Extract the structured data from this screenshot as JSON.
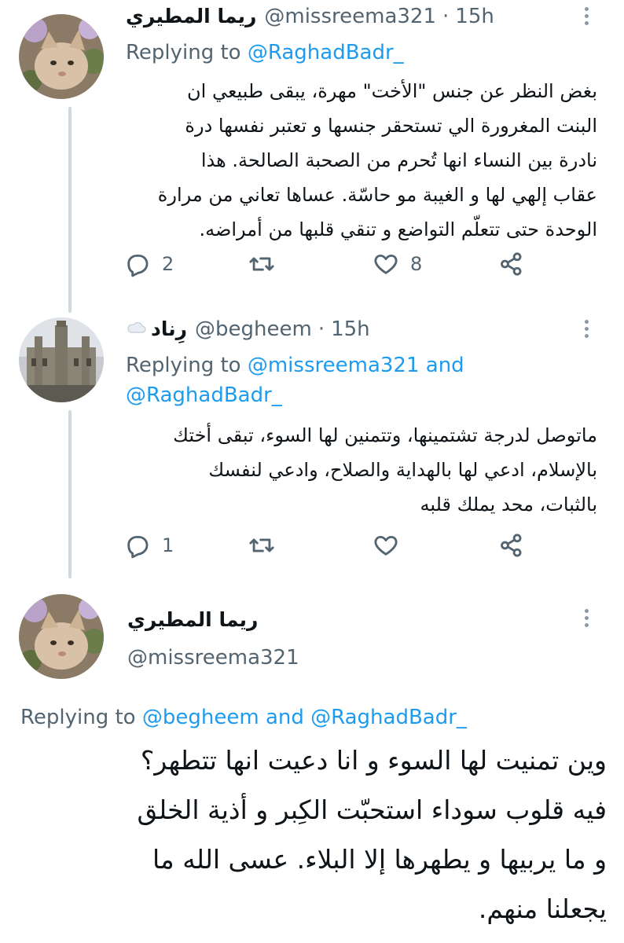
{
  "tweet1": {
    "name": "ريما المطيري",
    "handle": "@missreema321",
    "time": "15h",
    "reply_prefix": "Replying to",
    "reply_to": "@RaghadBadr_",
    "text_lines": [
      "بغض النظر عن جنس \"الأخت\" مهرة، يبقى طبيعي ان",
      "البنت المغرورة الي تستحقر جنسها و تعتبر نفسها درة",
      "نادرة بين النساء انها تُحرم من الصحبة الصالحة. هذا",
      "عقاب إلهي لها و الغيبة مو حاسّة. عساها تعاني من مرارة",
      "الوحدة حتى تتعلّم التواضع و تنقي قلبها من أمراضه."
    ],
    "replies": "2",
    "likes": "8"
  },
  "tweet2": {
    "name": "رِناد",
    "handle": "@begheem",
    "time": "15h",
    "reply_prefix": "Replying to",
    "reply_to_1": "@missreema321",
    "reply_and": "and",
    "reply_to_2": "@RaghadBadr_",
    "text_lines": [
      "ماتوصل لدرجة تشتمينها، وتتمنين لها السوء، تبقى أختك",
      "بالإسلام، ادعي لها بالهداية والصلاح، وادعي لنفسك",
      "بالثبات، محد يملك قلبه"
    ],
    "replies": "1"
  },
  "tweet3": {
    "name": "ريما المطيري",
    "handle": "@missreema321",
    "reply_prefix": "Replying to",
    "reply_to_1": "@begheem",
    "reply_and": "and",
    "reply_to_2": "@RaghadBadr_",
    "text_lines": [
      "وين تمنيت لها السوء و انا دعيت انها تتطهر؟",
      "فيه قلوب سوداء استحبّت الكِبر و أذية الخلق",
      "و ما يربيها و يطهرها إلا البلاء. عسى الله ما",
      "يجعلنا منهم."
    ]
  },
  "icons": {
    "reply": "reply-icon",
    "retweet": "retweet-icon",
    "like": "heart-icon",
    "share": "share-icon",
    "more": "more-icon"
  },
  "colors": {
    "accent": "#1d9bf0",
    "secondary_text": "#536471",
    "thread_line": "#cfd9de"
  }
}
